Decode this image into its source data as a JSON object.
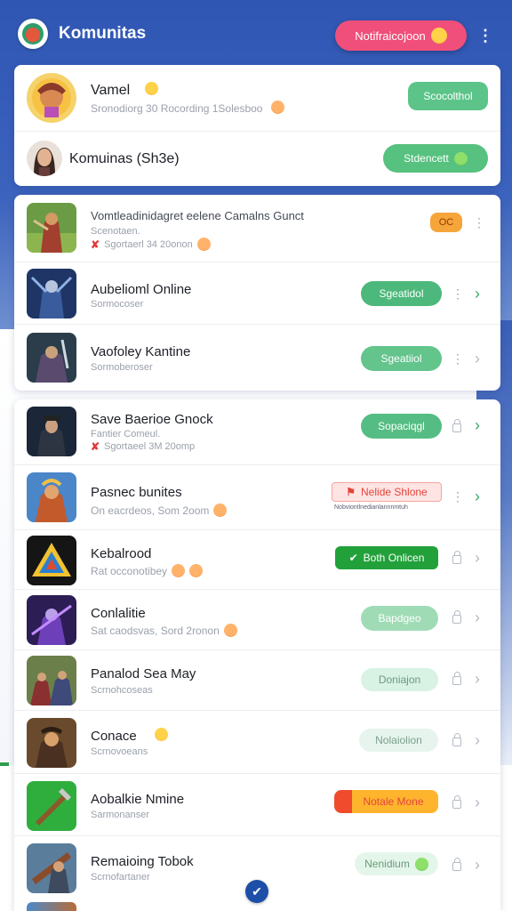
{
  "app": {
    "title": "Komunitas",
    "notification_pill": "Notifraicojoon"
  },
  "profiles": [
    {
      "name": "Vamel",
      "subtitle": "Sronodiorg 30 Rocording 1Solesboo",
      "button": "Scocolthol",
      "button_color": "#5cc489"
    },
    {
      "name": "Komuinas (Sh3e)",
      "button": "Stdencett",
      "button_color": "#57c17f"
    }
  ],
  "games_group_1": [
    {
      "title": "Vomtleadinidagret eelene Camalns Gunct",
      "subtitle": "Scenotaen.",
      "meta": "Sgortaerl 34 20onon",
      "badge": "OC",
      "badge_color": "#f6a53b"
    },
    {
      "title": "Aubelioml Online",
      "subtitle": "Sormocoser",
      "button": "Sgeatidol",
      "button_color": "#4cb87b"
    },
    {
      "title": "Vaofoley Kantine",
      "subtitle": "Sormoberoser",
      "button": "Sgeatiiol",
      "button_color": "#63c48c"
    }
  ],
  "games_group_2": [
    {
      "title": "Save Baerioe Gnock",
      "subtitle": "Fantier Comeul.",
      "meta": "Sgortaeel 3M 20omp",
      "button": "Sopaciqgl",
      "button_color": "#55bd83"
    },
    {
      "title": "Pasnec bunites",
      "subtitle": "On eacrdeos, Som 2oom",
      "button": "Nelide Shlone",
      "button_color": "#ffe4e4",
      "button_text_color": "#e2453a",
      "caption": "Nobviontlnedianlannnmtuh"
    },
    {
      "title": "Kebalrood",
      "subtitle": "Rat occonotibey",
      "button": "Both Onlicen",
      "button_color": "#22a13a"
    },
    {
      "title": "Conlalitie",
      "subtitle": "Sat caodsvas, Sord 2ronon",
      "button": "Bapdgeo",
      "button_color": "#9fdcb6"
    },
    {
      "title": "Panalod Sea May",
      "subtitle": "Scrnohcoseas",
      "button": "Doniajon",
      "button_color": "#d8f2e4",
      "button_text_color": "#6c9a80"
    },
    {
      "title": "Conace",
      "subtitle": "Scrnovoeans",
      "button": "Nolaiolion",
      "button_color": "#e7f4ee",
      "button_text_color": "#7ca08c"
    },
    {
      "title": "Aobalkie Nmine",
      "subtitle": "Sarmonanser",
      "button": "Notale Mone",
      "button_color": "#ffb42e",
      "button_text_color": "#e2453a"
    },
    {
      "title": "Remaioing Tobok",
      "subtitle": "Scrnofartaner",
      "button": "Nenidium",
      "button_color": "#e4f6ea",
      "button_text_color": "#6a9b7c"
    }
  ]
}
